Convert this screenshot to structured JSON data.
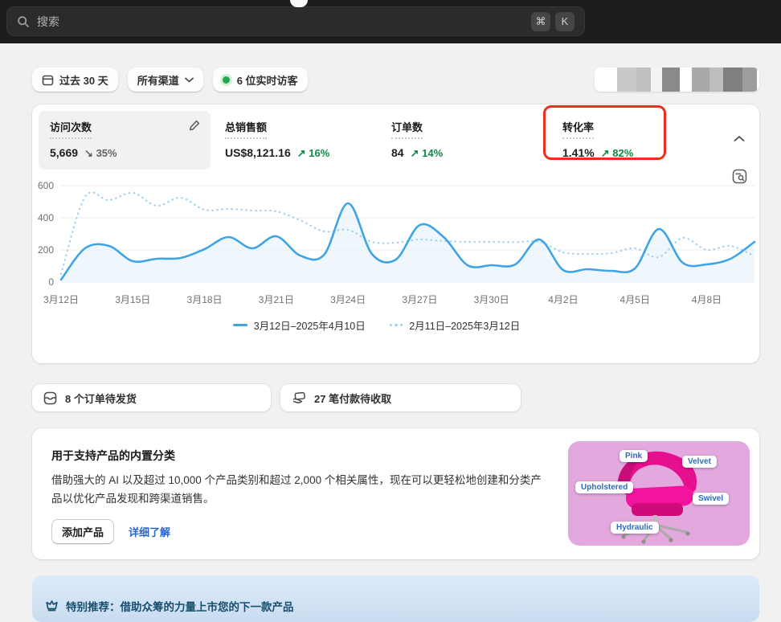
{
  "header": {
    "search_placeholder": "搜索",
    "key_cmd": "⌘",
    "key_k": "K"
  },
  "filters": {
    "date_range": "过去 30 天",
    "channel": "所有渠道",
    "live_visitors": "6 位实时访客"
  },
  "metrics": [
    {
      "label": "访问次数",
      "value": "5,669",
      "delta_arrow": "↘",
      "delta": "35%",
      "direction": "down",
      "selected": true
    },
    {
      "label": "总销售额",
      "value": "US$8,121.16",
      "delta_arrow": "↗",
      "delta": "16%",
      "direction": "up"
    },
    {
      "label": "订单数",
      "value": "84",
      "delta_arrow": "↗",
      "delta": "14%",
      "direction": "up"
    },
    {
      "label": "转化率",
      "value": "1.41%",
      "delta_arrow": "↗",
      "delta": "82%",
      "direction": "up",
      "annotated": true
    }
  ],
  "chart_data": {
    "type": "line",
    "x": [
      "3月12日",
      "3月13日",
      "3月14日",
      "3月15日",
      "3月16日",
      "3月17日",
      "3月18日",
      "3月19日",
      "3月20日",
      "3月21日",
      "3月22日",
      "3月23日",
      "3月24日",
      "3月25日",
      "3月26日",
      "3月27日",
      "3月28日",
      "3月29日",
      "3月30日",
      "3月31日",
      "4月1日",
      "4月2日",
      "4月3日",
      "4月4日",
      "4月5日",
      "4月6日",
      "4月7日",
      "4月8日",
      "4月9日",
      "4月10日"
    ],
    "xtick_every": 3,
    "series": [
      {
        "name": "3月12日–2025年4月10日",
        "style": "solid",
        "values": [
          15,
          210,
          225,
          130,
          145,
          150,
          205,
          280,
          210,
          285,
          165,
          170,
          490,
          175,
          140,
          355,
          280,
          105,
          105,
          110,
          265,
          75,
          80,
          70,
          85,
          330,
          120,
          110,
          145,
          250
        ]
      },
      {
        "name": "2月11日–2025年3月12日",
        "style": "dotted",
        "values": [
          50,
          530,
          510,
          555,
          475,
          525,
          450,
          455,
          445,
          440,
          385,
          315,
          325,
          250,
          245,
          265,
          255,
          250,
          250,
          248,
          252,
          185,
          175,
          180,
          210,
          155,
          275,
          200,
          225,
          160
        ]
      }
    ],
    "ylim": [
      0,
      600
    ],
    "yticks": [
      0,
      200,
      400,
      600
    ],
    "grid": true,
    "legend_position": "bottom"
  },
  "notifications": [
    {
      "label": "8 个订单待发货"
    },
    {
      "label": "27 笔付款待收取"
    }
  ],
  "product_card": {
    "title": "用于支持产品的内置分类",
    "body": "借助强大的 AI 以及超过 10,000 个产品类别和超过 2,000 个相关属性，现在可以更轻松地创建和分类产品以优化产品发现和跨渠道销售。",
    "primary_button": "添加产品",
    "link": "详细了解",
    "tags": [
      "Pink",
      "Velvet",
      "Upholstered",
      "Swivel",
      "Hydraulic"
    ]
  },
  "promo": {
    "text": "特别推荐：借助众筹的力量上市您的下一款产品"
  },
  "colors": {
    "chart_solid": "#3fa4e6",
    "chart_dotted": "#9ed2f2",
    "chart_fill": "#e9f4fc",
    "positive": "#108a46",
    "negative_neutral": "#636363",
    "annotation_red": "#ee2d1f",
    "link_blue": "#2a66c7",
    "panel_pink": "#e3a8dd"
  }
}
